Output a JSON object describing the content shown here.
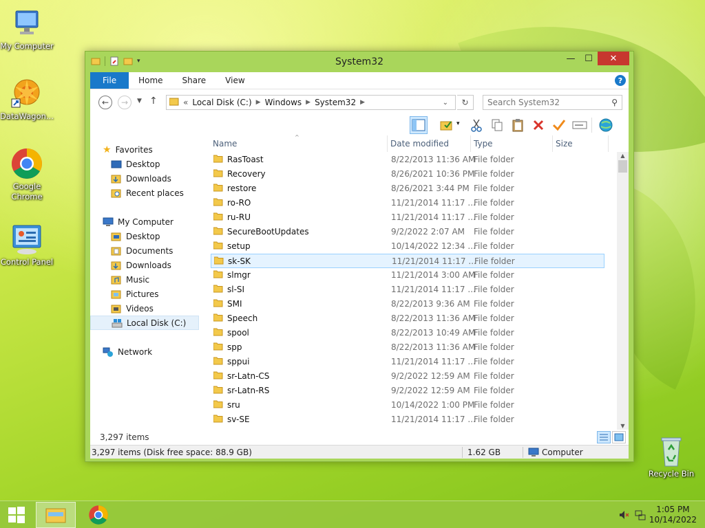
{
  "desktop": {
    "icons": [
      {
        "label": "My Computer"
      },
      {
        "label": "DataWagon..."
      },
      {
        "label": "Google Chrome"
      },
      {
        "label": "Control Panel"
      },
      {
        "label": "Recycle Bin"
      }
    ]
  },
  "window": {
    "title": "System32",
    "ribbon_tabs": [
      "File",
      "Home",
      "Share",
      "View"
    ],
    "help": "?",
    "address": {
      "prefix": "«",
      "crumbs": [
        "Local Disk (C:)",
        "Windows",
        "System32"
      ]
    },
    "search": {
      "placeholder": "Search System32"
    },
    "nav": {
      "favorites": "Favorites",
      "fav_items": [
        "Desktop",
        "Downloads",
        "Recent places"
      ],
      "computer": "My Computer",
      "computer_items": [
        "Desktop",
        "Documents",
        "Downloads",
        "Music",
        "Pictures",
        "Videos",
        "Local Disk (C:)"
      ],
      "network": "Network"
    },
    "columns": {
      "name": "Name",
      "date": "Date modified",
      "type": "Type",
      "size": "Size"
    },
    "files": [
      {
        "name": "RasToast",
        "date": "8/22/2013 11:36 AM",
        "type": "File folder"
      },
      {
        "name": "Recovery",
        "date": "8/26/2021 10:36 PM",
        "type": "File folder"
      },
      {
        "name": "restore",
        "date": "8/26/2021 3:44 PM",
        "type": "File folder"
      },
      {
        "name": "ro-RO",
        "date": "11/21/2014 11:17 ...",
        "type": "File folder"
      },
      {
        "name": "ru-RU",
        "date": "11/21/2014 11:17 ...",
        "type": "File folder"
      },
      {
        "name": "SecureBootUpdates",
        "date": "9/2/2022 2:07 AM",
        "type": "File folder"
      },
      {
        "name": "setup",
        "date": "10/14/2022 12:34 ...",
        "type": "File folder"
      },
      {
        "name": "sk-SK",
        "date": "11/21/2014 11:17 ...",
        "type": "File folder"
      },
      {
        "name": "slmgr",
        "date": "11/21/2014 3:00 AM",
        "type": "File folder"
      },
      {
        "name": "sl-SI",
        "date": "11/21/2014 11:17 ...",
        "type": "File folder"
      },
      {
        "name": "SMI",
        "date": "8/22/2013 9:36 AM",
        "type": "File folder"
      },
      {
        "name": "Speech",
        "date": "8/22/2013 11:36 AM",
        "type": "File folder"
      },
      {
        "name": "spool",
        "date": "8/22/2013 10:49 AM",
        "type": "File folder"
      },
      {
        "name": "spp",
        "date": "8/22/2013 11:36 AM",
        "type": "File folder"
      },
      {
        "name": "sppui",
        "date": "11/21/2014 11:17 ...",
        "type": "File folder"
      },
      {
        "name": "sr-Latn-CS",
        "date": "9/2/2022 12:59 AM",
        "type": "File folder"
      },
      {
        "name": "sr-Latn-RS",
        "date": "9/2/2022 12:59 AM",
        "type": "File folder"
      },
      {
        "name": "sru",
        "date": "10/14/2022 1:00 PM",
        "type": "File folder"
      },
      {
        "name": "sv-SE",
        "date": "11/21/2014 11:17 ...",
        "type": "File folder"
      }
    ],
    "selected_file": "sk-SK",
    "item_count": "3,297 items",
    "status": {
      "left": "3,297 items (Disk free space: 88.9 GB)",
      "size": "1.62 GB",
      "location": "Computer"
    }
  },
  "taskbar": {
    "time": "1:05 PM",
    "date": "10/14/2022"
  },
  "colors": {
    "accent": "#1979ca",
    "window_frame": "#a9d65b",
    "selection": "#e5f3ff"
  }
}
